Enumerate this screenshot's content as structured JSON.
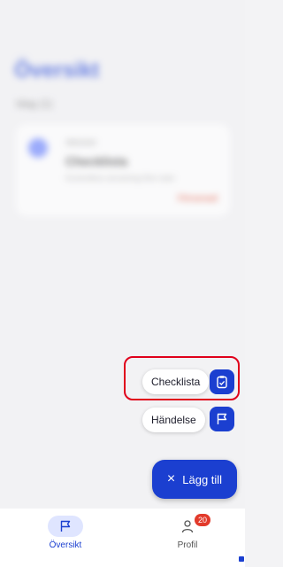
{
  "background": {
    "title": "Översikt",
    "subtitle": "Idag (1)",
    "card": {
      "meta": "Aktivitet",
      "title": "Checklista",
      "desc": "Kontrollera utrustning före start",
      "status": "Försenad"
    }
  },
  "menu": {
    "checklist_label": "Checklista",
    "event_label": "Händelse"
  },
  "fab": {
    "close_glyph": "×",
    "label": "Lägg till"
  },
  "tabbar": {
    "overview_label": "Översikt",
    "profile_label": "Profil",
    "profile_badge": "20"
  },
  "colors": {
    "accent": "#1b3fd0",
    "highlight": "#e0001b",
    "badge": "#e23a2b"
  }
}
